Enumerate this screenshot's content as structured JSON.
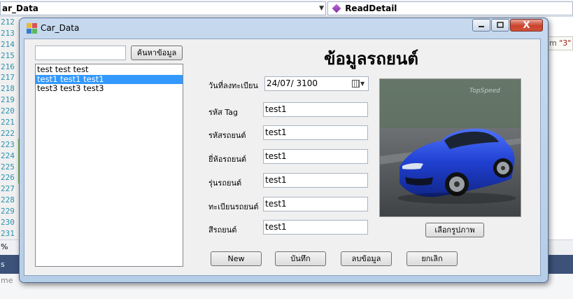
{
  "ide": {
    "left_combo": "ar_Data",
    "right_combo": "ReadDetail",
    "line_numbers": [
      "212",
      "213",
      "214",
      "215",
      "216",
      "217",
      "218",
      "219",
      "220",
      "221",
      "222",
      "223",
      "224",
      "225",
      "226",
      "227",
      "228",
      "229",
      "230",
      "231"
    ],
    "hint_prefix": "m",
    "hint_value": "\"3\" (",
    "zoom": "%",
    "panel_title": "s",
    "panel_text": "me"
  },
  "window": {
    "title": "Car_Data",
    "close_glyph": "X"
  },
  "search": {
    "value": "",
    "button_label": "ค้นหาข้อมูล"
  },
  "list": {
    "items": [
      "test  test  test",
      "test1 test1 test1",
      "test3 test3 test3"
    ],
    "selected_index": 1
  },
  "form": {
    "title": "ข้อมูลรถยนต์",
    "reg_date_label": "วันที่ลงทะเบียน",
    "reg_date_value": "24/07/  3100",
    "tag_label": "รหัส Tag",
    "tag_value": "test1",
    "car_code_label": "รหัสรถยนต์",
    "car_code_value": "test1",
    "brand_label": "ยี่ห้อรถยนต์",
    "brand_value": "test1",
    "model_label": "รุ่นรถยนต์",
    "model_value": "test1",
    "plate_label": "ทะเบียนรถยนต์",
    "plate_value": "test1",
    "color_label": "สีรถยนต์",
    "color_value": "test1"
  },
  "photo": {
    "watermark": "TopSpeed",
    "choose_button": "เลือกรูปภาพ"
  },
  "actions": {
    "new": "New",
    "save": "บันทึก",
    "delete": "ลบข้อมูล",
    "cancel": "ยกเลิก"
  },
  "colors": {
    "selection": "#3399ff",
    "car_body": "#1f3fcf",
    "window_frame": "#b6cde7",
    "close_button": "#c8422b"
  }
}
